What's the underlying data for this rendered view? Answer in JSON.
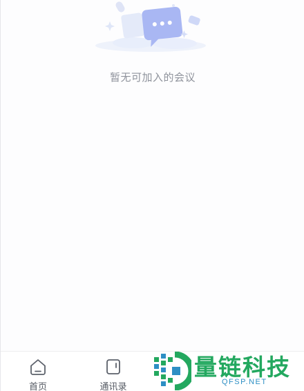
{
  "empty_state": {
    "illustration": "chat-bubble-empty-icon",
    "message": "暂无可加入的会议"
  },
  "tabbar": {
    "tabs": [
      {
        "label": "首页",
        "icon": "home-icon"
      },
      {
        "label": "通讯录",
        "icon": "contacts-icon"
      }
    ]
  },
  "watermark": {
    "title": "量链科技",
    "subtitle": "QFSP.NET"
  },
  "colors": {
    "illustration_bubble": "#aab8f5",
    "text_muted": "#8f939c",
    "tab_text": "#555a63",
    "watermark_green": "#23a85f",
    "watermark_blue": "#2d8fc4"
  }
}
